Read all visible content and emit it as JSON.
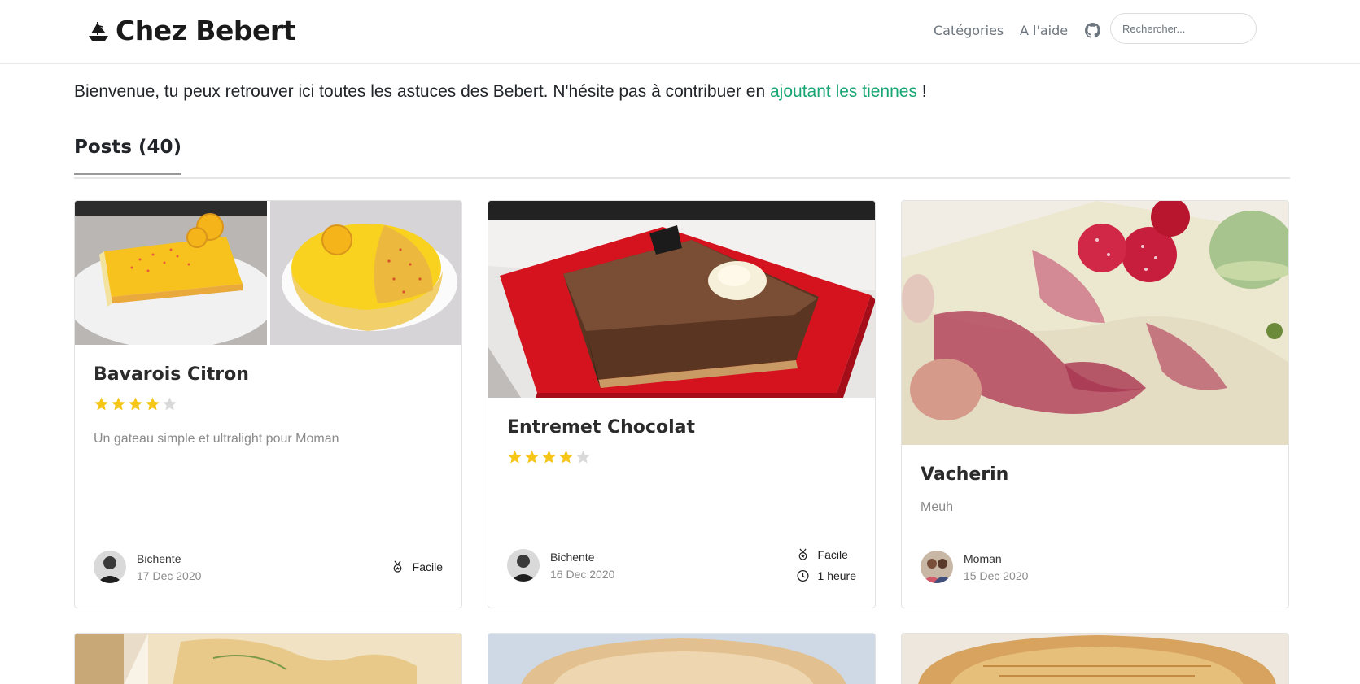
{
  "header": {
    "brand_name": "Chez Bebert",
    "nav": {
      "categories": "Catégories",
      "help": "A l'aide"
    },
    "search_placeholder": "Rechercher..."
  },
  "intro": {
    "text_before": "Bienvenue, tu peux retrouver ici toutes les astuces des Bebert. N'hésite pas à contribuer en ",
    "link_text": "ajoutant les tiennes",
    "text_after": " !"
  },
  "section": {
    "title": "Posts (40)"
  },
  "posts": [
    {
      "title": "Bavarois Citron",
      "rating": 4,
      "rating_max": 5,
      "excerpt": "Un gateau simple et ultralight pour Moman",
      "author": "Bichente",
      "date": "17 Dec 2020",
      "difficulty": "Facile"
    },
    {
      "title": "Entremet Chocolat",
      "rating": 4,
      "rating_max": 5,
      "excerpt": "",
      "author": "Bichente",
      "date": "16 Dec 2020",
      "difficulty": "Facile",
      "duration": "1 heure"
    },
    {
      "title": "Vacherin",
      "excerpt": "Meuh",
      "author": "Moman",
      "date": "15 Dec 2020"
    }
  ],
  "colors": {
    "accent_link": "#17a673",
    "star_filled": "#f5c518",
    "star_empty": "#d9d9d9",
    "muted_text": "#8a8a8a"
  },
  "icons": {
    "brand": "ship-logo-icon",
    "github": "github-icon",
    "difficulty": "medal-icon",
    "duration": "clock-icon",
    "star": "star-icon"
  }
}
